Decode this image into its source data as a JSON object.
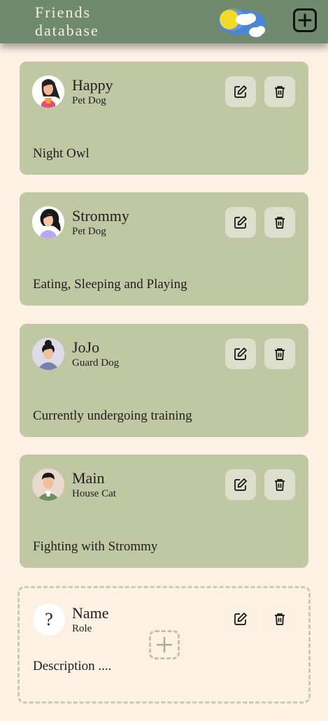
{
  "header": {
    "title": "Friends database",
    "weather_icon": "sun-cloud-icon",
    "add_icon": "plus-box-icon"
  },
  "friends": [
    {
      "name": "Happy",
      "role": "Pet Dog",
      "description": "Night Owl",
      "avatar_icon": "woman-avatar-icon"
    },
    {
      "name": "Strommy",
      "role": "Pet Dog",
      "description": "Eating, Sleeping and Playing",
      "avatar_icon": "woman-avatar-icon"
    },
    {
      "name": "JoJo",
      "role": "Guard Dog",
      "description": "Currently undergoing training",
      "avatar_icon": "woman-avatar-icon"
    },
    {
      "name": "Main",
      "role": "House Cat",
      "description": "Fighting with Strommy",
      "avatar_icon": "man-avatar-icon"
    }
  ],
  "new_card": {
    "avatar_text": "?",
    "name": "Name",
    "role": "Role",
    "description": "Description ...."
  },
  "colors": {
    "header": "#6f8a6e",
    "background": "#fdf1e3",
    "card": "#bfc7a3",
    "button": "#dcdfcc"
  }
}
